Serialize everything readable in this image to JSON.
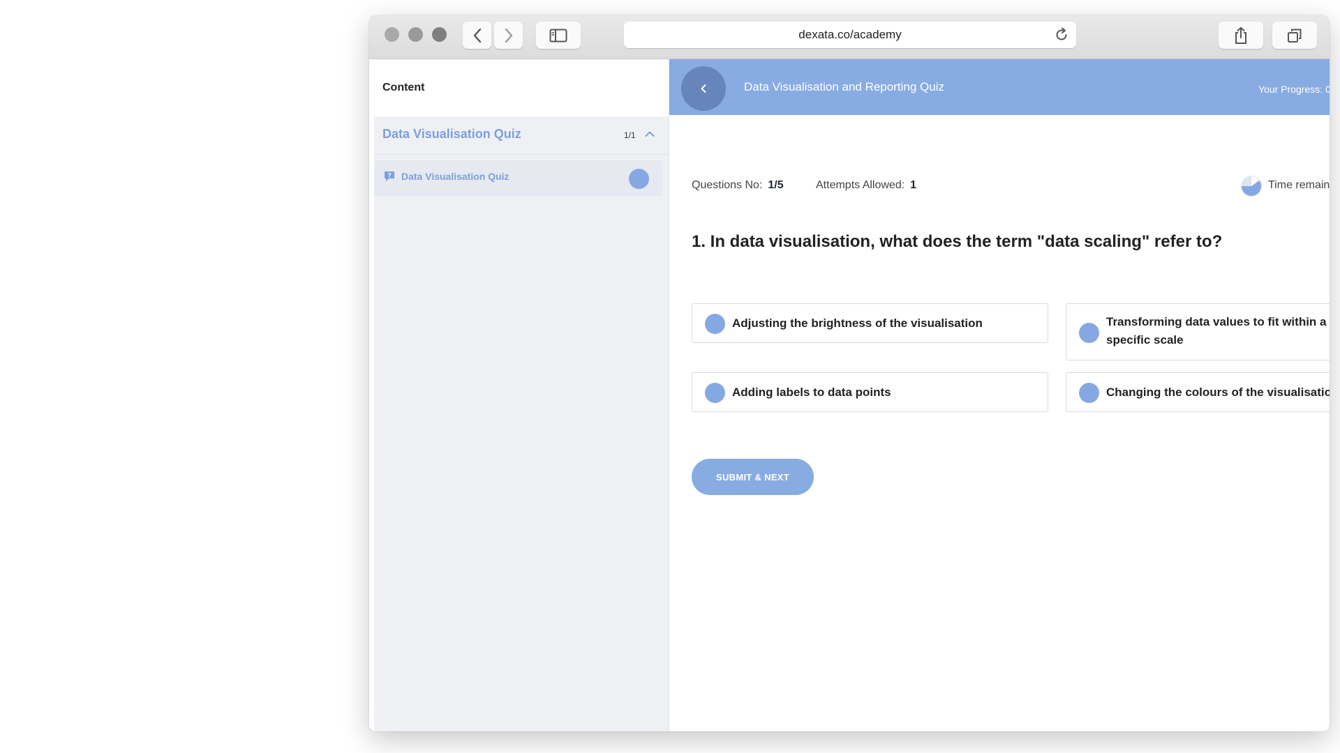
{
  "browser": {
    "url": "dexata.co/academy",
    "traffic_lights": [
      "#a9a9a9",
      "#9a9a9a",
      "#7f7f7f"
    ]
  },
  "sidebar": {
    "title": "Content",
    "section": {
      "title": "Data Visualisation Quiz",
      "count": "1/1",
      "items": [
        {
          "label": "Data Visualisation Quiz",
          "icon": "quiz-icon"
        }
      ]
    }
  },
  "header": {
    "title": "Data Visualisation and Reporting Quiz",
    "progress_label": "Your Progress: 0"
  },
  "quiz": {
    "questions_label": "Questions No:",
    "questions_value": "1/5",
    "attempts_label": "Attempts Allowed:",
    "attempts_value": "1",
    "time_label": "Time remaining",
    "question": "1. In data visualisation, what does the term \"data scaling\" refer to?",
    "options": [
      "Adjusting the brightness of the visualisation",
      "Transforming data values to fit within a specific scale",
      "Adding labels to data points",
      "Changing the colours of the visualisation"
    ],
    "submit_label": "SUBMIT & NEXT"
  },
  "colors": {
    "accent": "#88abe2",
    "accent_dark": "#6685bb",
    "link": "#7d9fdb",
    "sidebar_bg": "#eef0f4"
  }
}
